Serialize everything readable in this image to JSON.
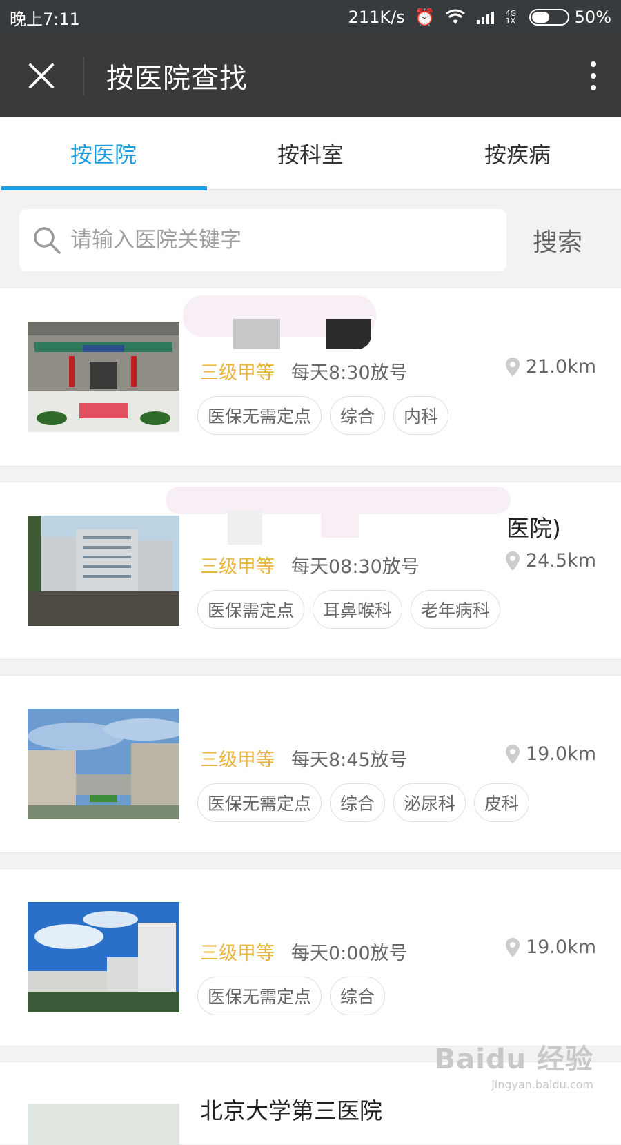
{
  "status_bar": {
    "time": "晚上7:11",
    "speed": "211K/s",
    "network_label": "4G 1X",
    "battery": "50%",
    "battery_level": 0.5
  },
  "nav": {
    "title": "按医院查找"
  },
  "tabs": [
    {
      "label": "按医院",
      "active": true
    },
    {
      "label": "按科室",
      "active": false
    },
    {
      "label": "按疾病",
      "active": false
    }
  ],
  "search": {
    "placeholder": "请输入医院关键字",
    "button_label": "搜索"
  },
  "hospitals": [
    {
      "name": "",
      "level": "三级甲等",
      "schedule": "每天8:30放号",
      "distance": "21.0km",
      "tags": [
        "医保无需定点",
        "综合",
        "内科"
      ]
    },
    {
      "name": "医院)",
      "level": "三级甲等",
      "schedule": "每天08:30放号",
      "distance": "24.5km",
      "tags": [
        "医保需定点",
        "耳鼻喉科",
        "老年病科"
      ]
    },
    {
      "name": "",
      "level": "三级甲等",
      "schedule": "每天8:45放号",
      "distance": "19.0km",
      "tags": [
        "医保无需定点",
        "综合",
        "泌尿科",
        "皮科"
      ]
    },
    {
      "name": "",
      "level": "三级甲等",
      "schedule": "每天0:00放号",
      "distance": "19.0km",
      "tags": [
        "医保无需定点",
        "综合"
      ]
    },
    {
      "name": "北京大学第三医院"
    }
  ],
  "watermark": {
    "top": "Baidu 经验",
    "bottom": "jingyan.baidu.com"
  },
  "colors": {
    "accent": "#1e9ee1",
    "level": "#e8b43a",
    "navbar": "#393a3c"
  }
}
